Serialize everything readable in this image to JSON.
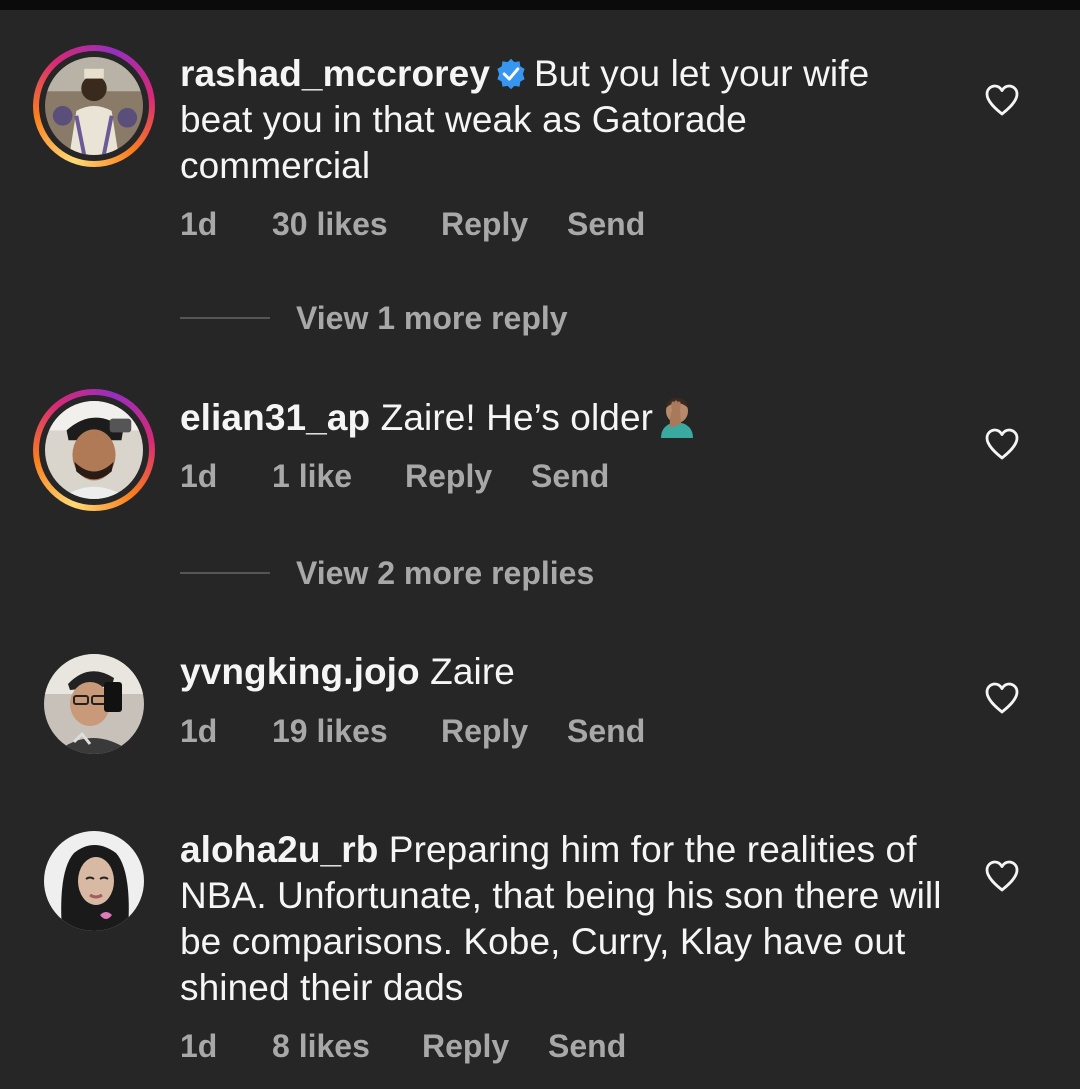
{
  "comments": [
    {
      "username": "rashad_mccrorey",
      "verified": true,
      "text": "But you let your wife beat you in that weak as Gatorade commercial",
      "time": "1d",
      "likes": "30 likes",
      "reply": "Reply",
      "send": "Send",
      "view_more": "View 1 more reply"
    },
    {
      "username": "elian31_ap",
      "verified": false,
      "text": "Zaire! He’s older",
      "emoji": "man-facepalming-icon",
      "time": "1d",
      "likes": "1 like",
      "reply": "Reply",
      "send": "Send",
      "view_more": "View 2 more replies"
    },
    {
      "username": "yvngking.jojo",
      "verified": false,
      "text": "Zaire",
      "time": "1d",
      "likes": "19 likes",
      "reply": "Reply",
      "send": "Send"
    },
    {
      "username": "aloha2u_rb",
      "verified": false,
      "text": "Preparing him for the realities of NBA. Unfortunate, that being his son there will be comparisons. Kobe, Curry, Klay have out shined their dads",
      "time": "1d",
      "likes": "8 likes",
      "reply": "Reply",
      "send": "Send"
    }
  ],
  "colors": {
    "background": "#262626",
    "text": "#f5f5f5",
    "muted": "#a8a8a8",
    "verified": "#3797f0"
  }
}
